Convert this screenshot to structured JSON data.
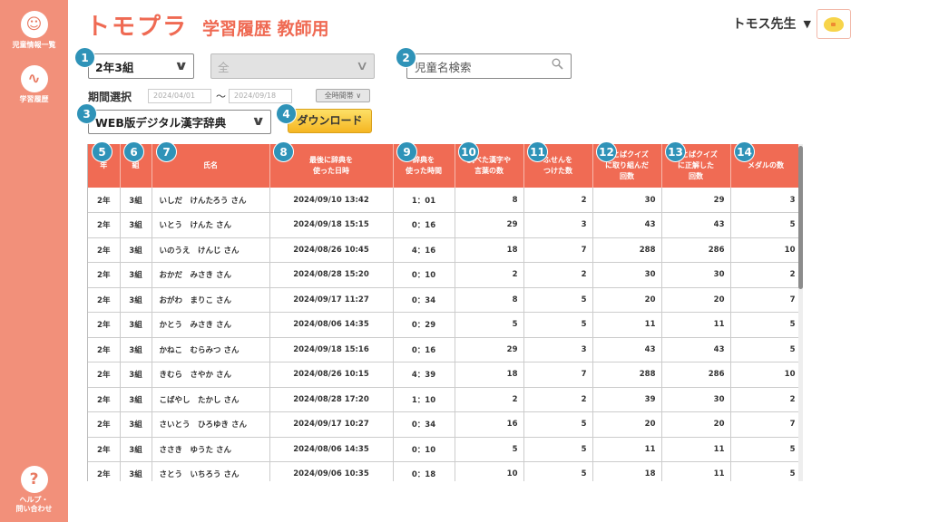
{
  "sidebar": {
    "items": [
      {
        "icon": "smile-icon",
        "glyph": "☺",
        "label": "児童情報一覧"
      },
      {
        "icon": "chart-icon",
        "glyph": "∿",
        "label": "学習履歴"
      }
    ],
    "help": {
      "glyph": "?",
      "label1": "ヘルプ・",
      "label2": "問い合わせ"
    }
  },
  "header": {
    "logo": "トモプラ",
    "subtitle": "学習履歴 教師用",
    "user": "トモス先生",
    "user_caret": "▼"
  },
  "badges": [
    "1",
    "2",
    "3",
    "4",
    "5",
    "6",
    "7",
    "8",
    "9",
    "10",
    "11",
    "12",
    "13",
    "14"
  ],
  "filters": {
    "class_select": "2年3組",
    "student_select": "全",
    "search_placeholder": "児童名検索",
    "period_label": "期間選択",
    "date_from": "2024/04/01",
    "date_sep": "〜",
    "date_to": "2024/09/18",
    "all_time": "全時間帯",
    "dictionary_select": "WEB版デジタル漢字辞典",
    "download_label": "ダウンロード"
  },
  "table": {
    "headers": [
      "年",
      "組",
      "氏名",
      "最後に辞典を使った日時",
      "辞典を使った時間",
      "調べた漢字や言葉の数",
      "ふせんをつけた数",
      "ことばクイズに取り組んだ回数",
      "ことばクイズに正解した回数",
      "メダルの数"
    ],
    "header_lines": [
      [
        "年"
      ],
      [
        "組"
      ],
      [
        "氏名"
      ],
      [
        "最後に辞典を",
        "使った日時"
      ],
      [
        "辞典を",
        "使った時間"
      ],
      [
        "調べた漢字や",
        "言葉の数"
      ],
      [
        "ふせんを",
        "つけた数"
      ],
      [
        "ことばクイズ",
        "に取り組んだ",
        "回数"
      ],
      [
        "ことばクイズ",
        "に正解した",
        "回数"
      ],
      [
        "メダルの数"
      ]
    ],
    "rows": [
      [
        "2年",
        "3組",
        "いしだ　けんたろう さん",
        "2024/09/10 13:42",
        "1：01",
        "8",
        "2",
        "30",
        "29",
        "3"
      ],
      [
        "2年",
        "3組",
        "いとう　けんた さん",
        "2024/09/18 15:15",
        "0：16",
        "29",
        "3",
        "43",
        "43",
        "5"
      ],
      [
        "2年",
        "3組",
        "いのうえ　けんじ さん",
        "2024/08/26 10:45",
        "4：16",
        "18",
        "7",
        "288",
        "286",
        "10"
      ],
      [
        "2年",
        "3組",
        "おかだ　みさき さん",
        "2024/08/28 15:20",
        "0：10",
        "2",
        "2",
        "30",
        "30",
        "2"
      ],
      [
        "2年",
        "3組",
        "おがわ　まりこ さん",
        "2024/09/17 11:27",
        "0：34",
        "8",
        "5",
        "20",
        "20",
        "7"
      ],
      [
        "2年",
        "3組",
        "かとう　みさき さん",
        "2024/08/06 14:35",
        "0：29",
        "5",
        "5",
        "11",
        "11",
        "5"
      ],
      [
        "2年",
        "3組",
        "かねこ　むらみつ さん",
        "2024/09/18 15:16",
        "0：16",
        "29",
        "3",
        "43",
        "43",
        "5"
      ],
      [
        "2年",
        "3組",
        "きむら　さやか さん",
        "2024/08/26 10:15",
        "4：39",
        "18",
        "7",
        "288",
        "286",
        "10"
      ],
      [
        "2年",
        "3組",
        "こばやし　たかし さん",
        "2024/08/28 17:20",
        "1：10",
        "2",
        "2",
        "39",
        "30",
        "2"
      ],
      [
        "2年",
        "3組",
        "さいとう　ひろゆき さん",
        "2024/09/17 10:27",
        "0：34",
        "16",
        "5",
        "20",
        "20",
        "7"
      ],
      [
        "2年",
        "3組",
        "ささき　ゆうた さん",
        "2024/08/06 14:35",
        "0：10",
        "5",
        "5",
        "11",
        "11",
        "5"
      ],
      [
        "2年",
        "3組",
        "さとう　いちろう さん",
        "2024/09/06 10:35",
        "0：18",
        "10",
        "5",
        "18",
        "11",
        "5"
      ]
    ]
  },
  "colors": {
    "sidebar": "#f2907a",
    "brand": "#ef6a53",
    "header_bg": "#f06b54",
    "badge": "#2f93b8",
    "download": "#f5b622"
  }
}
